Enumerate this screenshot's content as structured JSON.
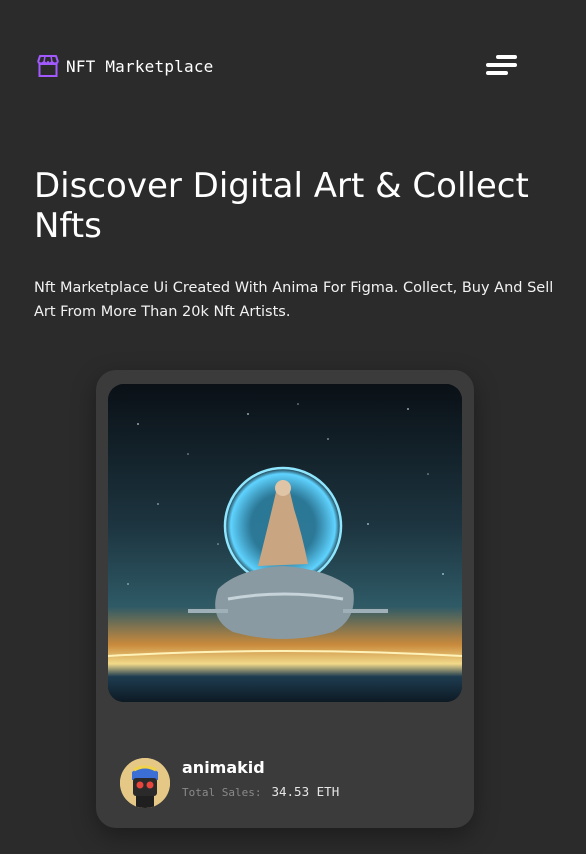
{
  "header": {
    "brand_name": "NFT Marketplace",
    "brand_icon": "storefront-icon",
    "menu_icon": "hamburger-menu-icon",
    "accent_color": "#a259ff"
  },
  "hero": {
    "title": "Discover Digital Art & Collect Nfts",
    "subtitle": "Nft Marketplace Ui Created With Anima For Figma. Collect, Buy And Sell Art From More Than 20k Nft Artists."
  },
  "featured_nft": {
    "artist_name": "animakid",
    "total_sales_label": "Total Sales:",
    "total_sales_value": "34.53 ETH"
  },
  "colors": {
    "background": "#2b2b2b",
    "card": "#3b3b3b",
    "text_primary": "#ffffff",
    "text_muted": "#8a8a8a"
  }
}
